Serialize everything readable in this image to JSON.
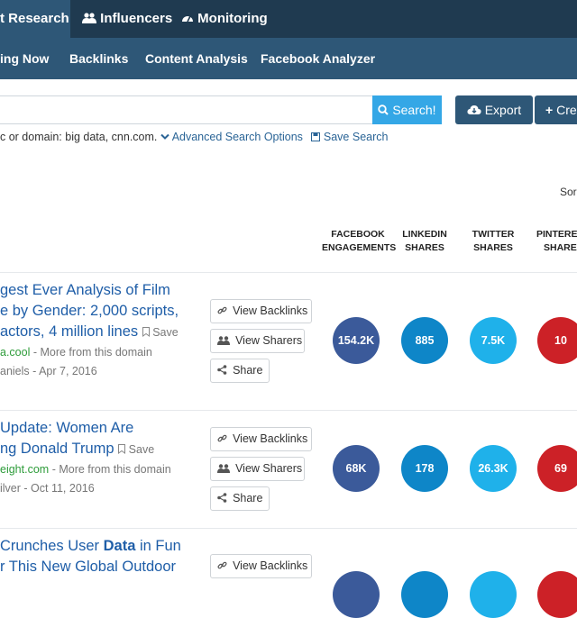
{
  "top_nav": {
    "tabs": [
      {
        "label": "t Research",
        "active": true
      },
      {
        "label": "Influencers"
      },
      {
        "label": "Monitoring"
      }
    ]
  },
  "sub_nav": {
    "items": [
      "ing Now",
      "Backlinks",
      "Content Analysis",
      "Facebook Analyzer"
    ]
  },
  "search": {
    "value": "",
    "button_label": "Search!",
    "hint": "c or domain: big data, cnn.com.",
    "advanced_label": "Advanced Search Options",
    "save_search_label": "Save Search"
  },
  "toolbar": {
    "export_label": "Export",
    "create_label": "Cre"
  },
  "sort_label": "Sor",
  "columns": [
    {
      "line1": "FACEBOOK",
      "line2": "ENGAGEMENTS"
    },
    {
      "line1": "LINKEDIN",
      "line2": "SHARES"
    },
    {
      "line1": "TWITTER",
      "line2": "SHARES"
    },
    {
      "line1": "PINTERES",
      "line2": "SHARES"
    }
  ],
  "articles": [
    {
      "title_line1": "gest Ever Analysis of Film",
      "title_line2": "e by Gender: 2,000 scripts,",
      "title_line3": "actors, 4 million lines",
      "save_label": "Save",
      "domain": "a.cool",
      "more": "More from this domain",
      "author_date": "aniels - Apr 7, 2016",
      "buttons": [
        "View Backlinks",
        "View Sharers",
        "Share"
      ],
      "metrics": [
        "154.2K",
        "885",
        "7.5K",
        "10"
      ]
    },
    {
      "title_line1": "Update: Women Are",
      "title_line2": "ng Donald Trump",
      "save_label": "Save",
      "domain": "eight.com",
      "more": "More from this domain",
      "author_date": "ilver - Oct 11, 2016",
      "buttons": [
        "View Backlinks",
        "View Sharers",
        "Share"
      ],
      "metrics": [
        "68K",
        "178",
        "26.3K",
        "69"
      ]
    },
    {
      "title_pre": "Crunches User ",
      "title_bold": "Data",
      "title_post": " in Fun",
      "title_line2": "r This New Global Outdoor",
      "buttons": [
        "View Backlinks"
      ]
    }
  ],
  "colors": {
    "topbar": "#1f3a50",
    "subbar": "#2e5777",
    "facebook": "#3b5a9a",
    "linkedin": "#0e86c8",
    "twitter": "#1fb1ea",
    "pinterest": "#cc2127"
  }
}
